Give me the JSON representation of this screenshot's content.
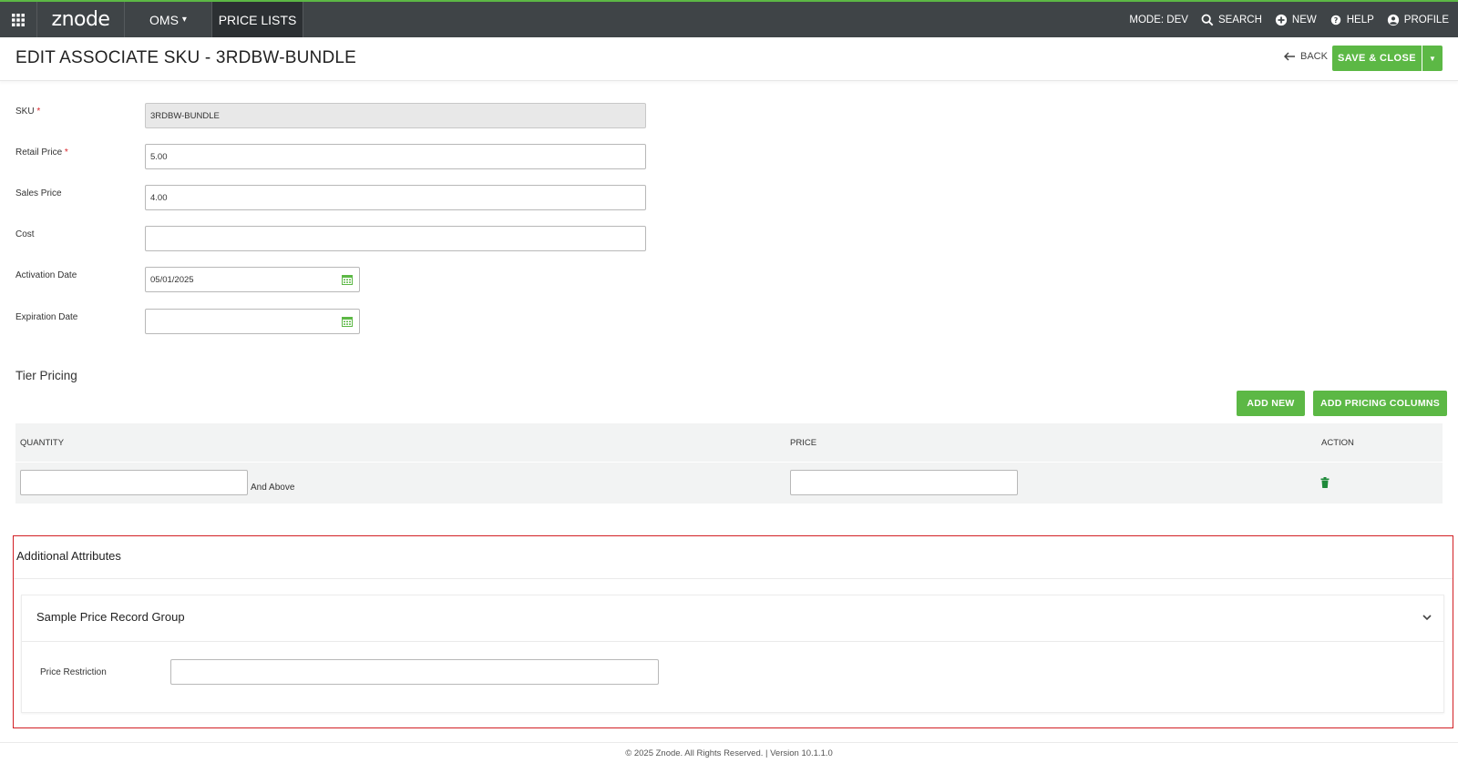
{
  "topbar": {
    "logo": "znode",
    "oms_label": "OMS",
    "price_lists_label": "PRICE LISTS",
    "mode_label": "MODE: DEV",
    "search_label": "SEARCH",
    "new_label": "NEW",
    "help_label": "HELP",
    "profile_label": "PROFILE"
  },
  "header": {
    "title": "EDIT ASSOCIATE SKU  -  3RDBW-BUNDLE",
    "back_label": "BACK",
    "save_label": "SAVE & CLOSE"
  },
  "form": {
    "sku_label": "SKU",
    "sku_value": "3RDBW-BUNDLE",
    "retail_label": "Retail Price",
    "retail_value": "5.00",
    "sales_label": "Sales Price",
    "sales_value": "4.00",
    "cost_label": "Cost",
    "cost_value": "",
    "activation_label": "Activation Date",
    "activation_value": "05/01/2025",
    "expiration_label": "Expiration Date",
    "expiration_value": "",
    "required_mark": "*"
  },
  "tier": {
    "title": "Tier Pricing",
    "add_new_label": "ADD NEW",
    "add_columns_label": "ADD PRICING COLUMNS",
    "headers": {
      "quantity": "QUANTITY",
      "price": "PRICE",
      "action": "ACTION"
    },
    "and_above": "And Above",
    "quantity_value": "",
    "price_value": ""
  },
  "additional": {
    "title": "Additional Attributes",
    "group_title": "Sample Price Record Group",
    "price_restriction_label": "Price Restriction",
    "price_restriction_value": ""
  },
  "footer": {
    "text": "© 2025 Znode. All Rights Reserved. | Version 10.1.1.0"
  },
  "colors": {
    "accent": "#5cb845",
    "topbar": "#3f4447",
    "highlight_border": "#d21f24"
  }
}
